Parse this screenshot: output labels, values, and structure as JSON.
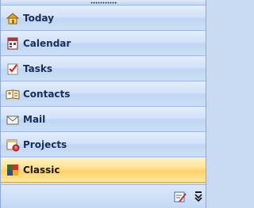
{
  "nav_pane": {
    "items": [
      {
        "label": "Today",
        "icon": "today-house-icon"
      },
      {
        "label": "Calendar",
        "icon": "calendar-icon"
      },
      {
        "label": "Tasks",
        "icon": "tasks-icon"
      },
      {
        "label": "Contacts",
        "icon": "contacts-icon"
      },
      {
        "label": "Mail",
        "icon": "mail-icon"
      },
      {
        "label": "Projects",
        "icon": "projects-icon"
      },
      {
        "label": "Classic",
        "icon": "classic-icon"
      }
    ],
    "active_item": "Classic",
    "footer": {
      "configure_icon": "configure-buttons-icon",
      "more_icon": "chevron-more-icon"
    }
  },
  "colors": {
    "pane_background": "#cfe0f6",
    "label_text": "#15305b",
    "active_highlight": "#ffd067",
    "border": "#9db8de"
  }
}
